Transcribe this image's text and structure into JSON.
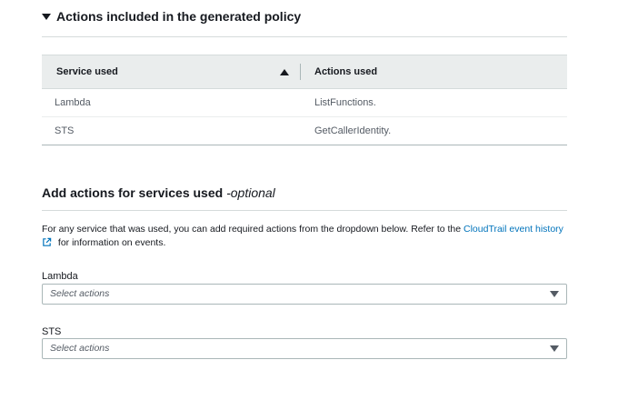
{
  "included_section": {
    "title": "Actions included in the generated policy",
    "table": {
      "headers": {
        "service": "Service used",
        "actions": "Actions used"
      },
      "rows": [
        {
          "service": "Lambda",
          "actions": "ListFunctions."
        },
        {
          "service": "STS",
          "actions": "GetCallerIdentity."
        }
      ]
    }
  },
  "add_section": {
    "title": "Add actions for services used ",
    "title_optional": "-optional",
    "description_before": "For any service that was used, you can add required actions from the dropdown below. Refer to the ",
    "link_text": "CloudTrail event history",
    "description_after": " for information on events.",
    "fields": [
      {
        "label": "Lambda",
        "placeholder": "Select actions"
      },
      {
        "label": "STS",
        "placeholder": "Select actions"
      }
    ]
  },
  "colors": {
    "link": "#0073bb",
    "header_bg": "#eaeded",
    "text": "#16191f"
  }
}
